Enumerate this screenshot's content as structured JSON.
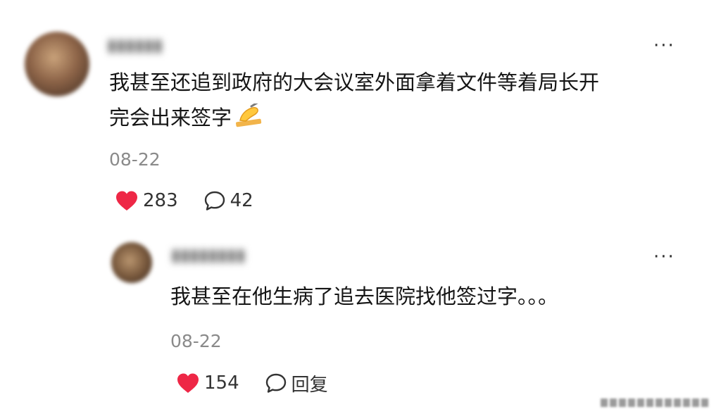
{
  "comment": {
    "text_line1": "我甚至还追到政府的大会议室外面拿着文件等着局长开",
    "text_line2": "完会出来签字",
    "date": "08-22",
    "likes": "283",
    "comments": "42",
    "more_label": "···"
  },
  "reply": {
    "text": "我甚至在他生病了追去医院找他签过字。。。",
    "date": "08-22",
    "likes": "154",
    "reply_label": "回复",
    "more_label": "···"
  },
  "colors": {
    "heart": "#ee2746",
    "muted": "#8a8a8a"
  },
  "icons": {
    "like": "heart-icon",
    "comment": "speech-bubble-icon",
    "reply": "speech-bubble-icon",
    "more": "more-dots-icon",
    "emoji": "writing-hand-emoji"
  }
}
